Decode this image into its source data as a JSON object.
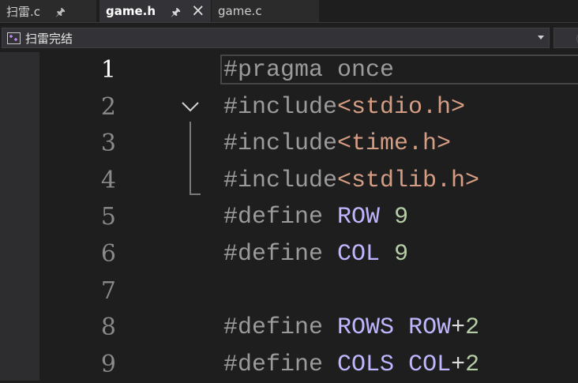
{
  "tabs": [
    {
      "label": "扫雷.c",
      "pinned": true,
      "active": false
    },
    {
      "label": "game.h",
      "pinned": true,
      "active": true,
      "closable": true
    },
    {
      "label": "game.c",
      "pinned": false,
      "active": false
    }
  ],
  "icons": {
    "pin": "pin-icon",
    "close": "close-icon",
    "scope": "project-scope-icon",
    "fold": "chevron-down-icon"
  },
  "navbar": {
    "scope_label": "扫雷完结"
  },
  "editor": {
    "current_line": 1,
    "lines": [
      {
        "number": "1",
        "tokens": [
          {
            "text": "#pragma once",
            "kind": "directive"
          }
        ]
      },
      {
        "number": "2",
        "tokens": [
          {
            "text": "#include",
            "kind": "directive"
          },
          {
            "text": "<stdio.h>",
            "kind": "string"
          }
        ]
      },
      {
        "number": "3",
        "tokens": [
          {
            "text": "#include",
            "kind": "directive"
          },
          {
            "text": "<time.h>",
            "kind": "string"
          }
        ]
      },
      {
        "number": "4",
        "tokens": [
          {
            "text": "#include",
            "kind": "directive"
          },
          {
            "text": "<stdlib.h>",
            "kind": "string"
          }
        ]
      },
      {
        "number": "5",
        "tokens": [
          {
            "text": "#define ",
            "kind": "directive"
          },
          {
            "text": "ROW",
            "kind": "macro"
          },
          {
            "text": " ",
            "kind": "plain"
          },
          {
            "text": "9",
            "kind": "number"
          }
        ]
      },
      {
        "number": "6",
        "tokens": [
          {
            "text": "#define ",
            "kind": "directive"
          },
          {
            "text": "COL",
            "kind": "macro"
          },
          {
            "text": " ",
            "kind": "plain"
          },
          {
            "text": "9",
            "kind": "number"
          }
        ]
      },
      {
        "number": "7",
        "tokens": []
      },
      {
        "number": "8",
        "tokens": [
          {
            "text": "#define ",
            "kind": "directive"
          },
          {
            "text": "ROWS",
            "kind": "macro"
          },
          {
            "text": " ",
            "kind": "plain"
          },
          {
            "text": "ROW",
            "kind": "macro"
          },
          {
            "text": "+",
            "kind": "plain"
          },
          {
            "text": "2",
            "kind": "number"
          }
        ]
      },
      {
        "number": "9",
        "tokens": [
          {
            "text": "#define ",
            "kind": "directive"
          },
          {
            "text": "COLS",
            "kind": "macro"
          },
          {
            "text": " ",
            "kind": "plain"
          },
          {
            "text": "COL",
            "kind": "macro"
          },
          {
            "text": "+",
            "kind": "plain"
          },
          {
            "text": "2",
            "kind": "number"
          }
        ]
      }
    ]
  },
  "colors": {
    "editor_bg": "#1e1e1e",
    "directive": "#9b9b9b",
    "string": "#d69d85",
    "macro": "#beb7ff",
    "number": "#b5cea8",
    "line_number": "#8a8a8a",
    "line_number_current": "#ffffff"
  }
}
